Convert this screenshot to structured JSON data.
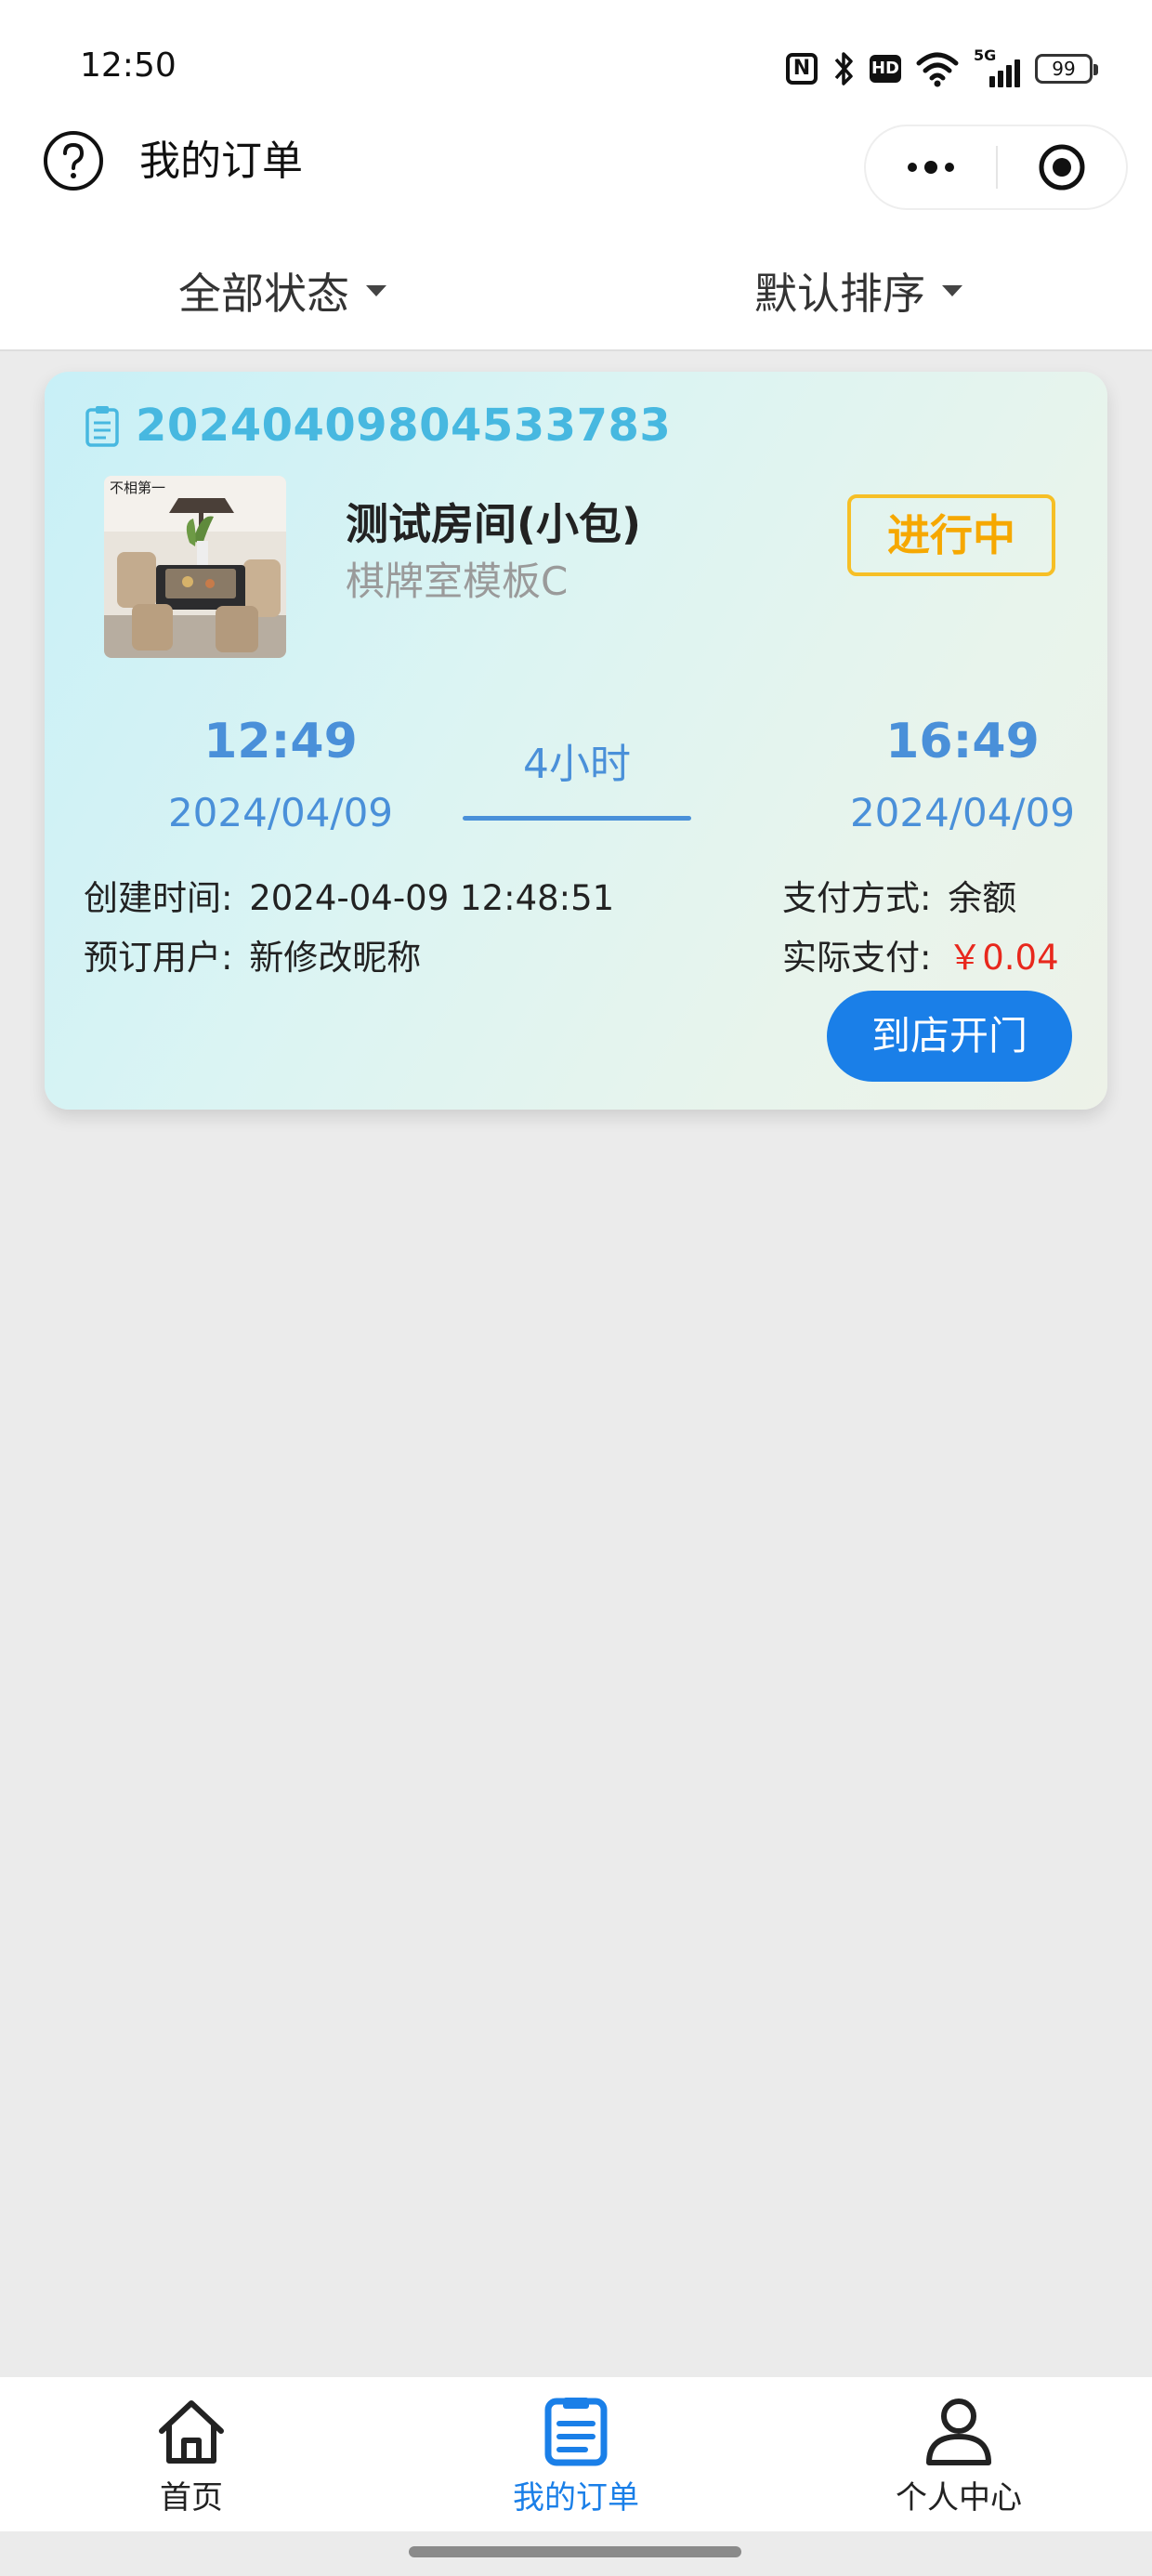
{
  "status_bar": {
    "time": "12:50",
    "nfc": "N",
    "hd": "HD",
    "network": "5G",
    "battery": "99"
  },
  "header": {
    "title": "我的订单"
  },
  "filters": {
    "status_label": "全部状态",
    "sort_label": "默认排序"
  },
  "order": {
    "order_no": "20240409804533783",
    "room_name": "测试房间(小包)",
    "room_template": "棋牌室模板C",
    "status": "进行中",
    "start_time": "12:49",
    "start_date": "2024/04/09",
    "duration": "4小时",
    "end_time": "16:49",
    "end_date": "2024/04/09",
    "created_label": "创建时间:",
    "created_value": "2024-04-09 12:48:51",
    "user_label": "预订用户:",
    "user_value": "新修改昵称",
    "pay_method_label": "支付方式:",
    "pay_method_value": "余额",
    "paid_label": "实际支付:",
    "paid_value": "￥0.04",
    "action_label": "到店开门",
    "thumb_sign_text": "不相第一"
  },
  "tabbar": {
    "items": [
      {
        "label": "首页"
      },
      {
        "label": "我的订单"
      },
      {
        "label": "个人中心"
      }
    ],
    "active_color": "#1a7fe8"
  },
  "colors": {
    "accent": "#1a7fe8",
    "order_no": "#47b8e0",
    "status_badge": "#f6bf26",
    "price": "#e8281d"
  }
}
